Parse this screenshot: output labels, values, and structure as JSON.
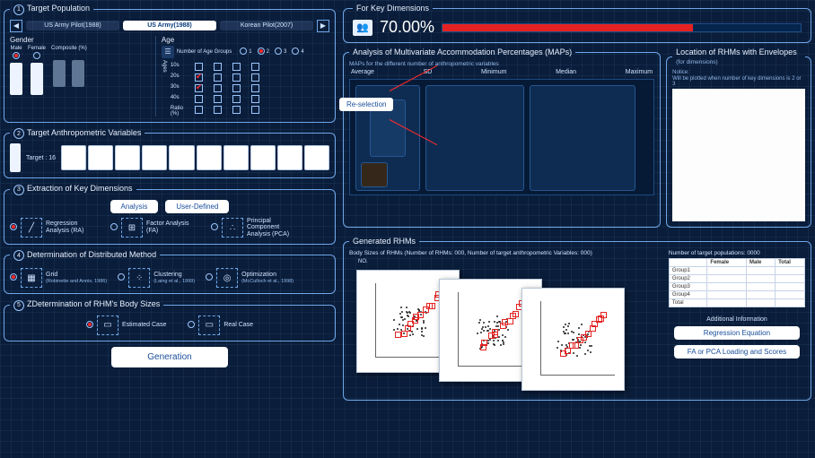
{
  "sections": {
    "s1": "Target Population",
    "s2": "Target Anthropometric Variables",
    "s3": "Extraction of Key Dimensions",
    "s4": "Determination of Distributed Method",
    "s5": "ZDetermination of RHM's Body Sizes"
  },
  "tabs": [
    "US Army Pilot(1988)",
    "US Army(1988)",
    "Korean Pilot(2007)"
  ],
  "gender": {
    "title": "Gender",
    "cols": [
      "Male",
      "Female",
      "Composite (%)"
    ]
  },
  "age": {
    "title": "Age",
    "head": "Number of Age Groups",
    "opts": [
      "1",
      "2",
      "3",
      "4"
    ],
    "rowLabel": "Ages",
    "rows": [
      "10s",
      "20s",
      "30s",
      "40s"
    ],
    "ratio": "Ratio (%)"
  },
  "anthro": {
    "target": "Target : 16"
  },
  "extract": {
    "btns": [
      "Analysis",
      "User-Defined"
    ],
    "opts": [
      {
        "name": "Regression Analysis (RA)",
        "sub": ""
      },
      {
        "name": "Factor Analysis (FA)",
        "sub": ""
      },
      {
        "name": "Principal Component Analysis (PCA)",
        "sub": ""
      }
    ]
  },
  "dist": {
    "opts": [
      {
        "name": "Grid",
        "sub": "(Robinette and Annis, 1986)"
      },
      {
        "name": "Clustering",
        "sub": "(Laing et al., 1999)"
      },
      {
        "name": "Optimization",
        "sub": "(McCulloch et al., 1998)"
      }
    ]
  },
  "sizes": {
    "opts": [
      "Estimated Case",
      "Real Case"
    ]
  },
  "generate": "Generation",
  "key": {
    "title": "For Key Dimensions",
    "pct": "70.00%"
  },
  "maps": {
    "title": "Analysis of Multivariate Accommodation Percentages (MAPs)",
    "sub": "MAPs for the different number of anthropometric variables",
    "stats": [
      "Average",
      "SD",
      "Minimum",
      "Median",
      "Maximum"
    ],
    "reselect": "Re-selection"
  },
  "loc": {
    "title": "Location of RHMs with Envelopes",
    "sub": "(for dimensions)",
    "notice": "Notice:",
    "noticeBody": "Will be plotted when number of key dimensions is 2 or 3"
  },
  "rhms": {
    "title": "Generated RHMs",
    "body": "Body Sizes of RHMs   (Number of RHMs:  000,   Number of target anthropometric Variables:  000)",
    "no": "NO."
  },
  "popTable": {
    "title": "Number of target populations:  0000",
    "headers": [
      "",
      "Female",
      "Male",
      "Total"
    ],
    "rows": [
      "Group1",
      "Group2",
      "Group3",
      "Group4",
      "Total"
    ]
  },
  "addl": {
    "label": "Additional Information",
    "btns": [
      "Regression Equation",
      "FA or PCA Loading and Scores"
    ]
  }
}
